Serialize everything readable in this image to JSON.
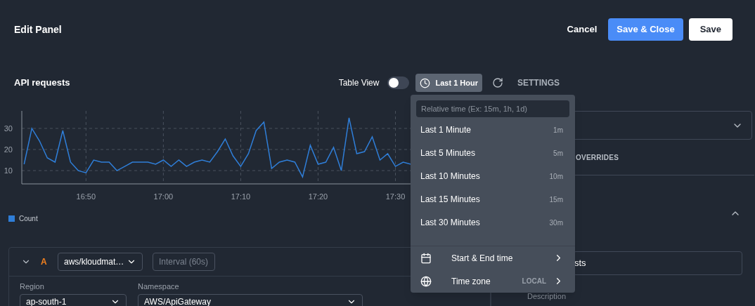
{
  "header": {
    "title": "Edit Panel",
    "buttons": [
      {
        "label": "Cancel",
        "kind": "text"
      },
      {
        "label": "Save & Close",
        "kind": "primary"
      },
      {
        "label": "Save",
        "kind": "light"
      }
    ]
  },
  "panel": {
    "title": "API requests",
    "table_view": {
      "label": "Table View",
      "on": false
    },
    "time_button": "Last 1 Hour",
    "settings_tab": "SETTINGS",
    "chart_data": {
      "type": "line",
      "categories": [
        null,
        null,
        null,
        null,
        null,
        null,
        null,
        null,
        "16:50",
        null,
        null,
        null,
        null,
        null,
        null,
        null,
        null,
        null,
        "17:00",
        null,
        null,
        null,
        null,
        null,
        null,
        null,
        null,
        null,
        "17:10",
        null,
        null,
        null,
        null,
        null,
        null,
        null,
        null,
        null,
        "17:20",
        null,
        null,
        null,
        null,
        null,
        null,
        null,
        null,
        null,
        "17:30",
        null,
        null
      ],
      "series": [
        {
          "name": "Count",
          "color": "#2f7ed8",
          "values": [
            13,
            30,
            24,
            16,
            14,
            29,
            14,
            10,
            9,
            15,
            14,
            14,
            10,
            12,
            14,
            14,
            14,
            13,
            15,
            12,
            15,
            12,
            14,
            15,
            14,
            19,
            25,
            17,
            12,
            18,
            29,
            33,
            11,
            14,
            15,
            14,
            7,
            22,
            13,
            14,
            21,
            10,
            35,
            18,
            19,
            26,
            15,
            18,
            12,
            14,
            13
          ]
        }
      ],
      "ylim": [
        3.7,
        38.3
      ],
      "yticks": [
        10,
        20,
        30
      ],
      "grid": true
    }
  },
  "query": {
    "ref": "A",
    "expanded": true,
    "datasource": "aws/kloudmat…",
    "interval_placeholder": "Interval (60s)",
    "fields": [
      {
        "label": "Region",
        "value": "ap-south-1"
      },
      {
        "label": "Namespace",
        "value": "AWS/ApiGateway"
      }
    ]
  },
  "options": {
    "tab": "OVERRIDES",
    "section_expanded": true,
    "title_value": "sts",
    "description_label": "Description"
  },
  "time_menu": {
    "placeholder": "Relative time (Ex: 15m, 1h, 1d)",
    "items": [
      {
        "label": "Last 1 Minute",
        "short": "1m"
      },
      {
        "label": "Last 5 Minutes",
        "short": "5m"
      },
      {
        "label": "Last 10 Minutes",
        "short": "10m"
      },
      {
        "label": "Last 15 Minutes",
        "short": "15m"
      },
      {
        "label": "Last 30 Minutes",
        "short": "30m"
      }
    ],
    "footer": [
      {
        "kind": "calendar",
        "label": "Start & End time"
      },
      {
        "kind": "globe",
        "label": "Time zone",
        "value": "LOCAL"
      }
    ]
  }
}
